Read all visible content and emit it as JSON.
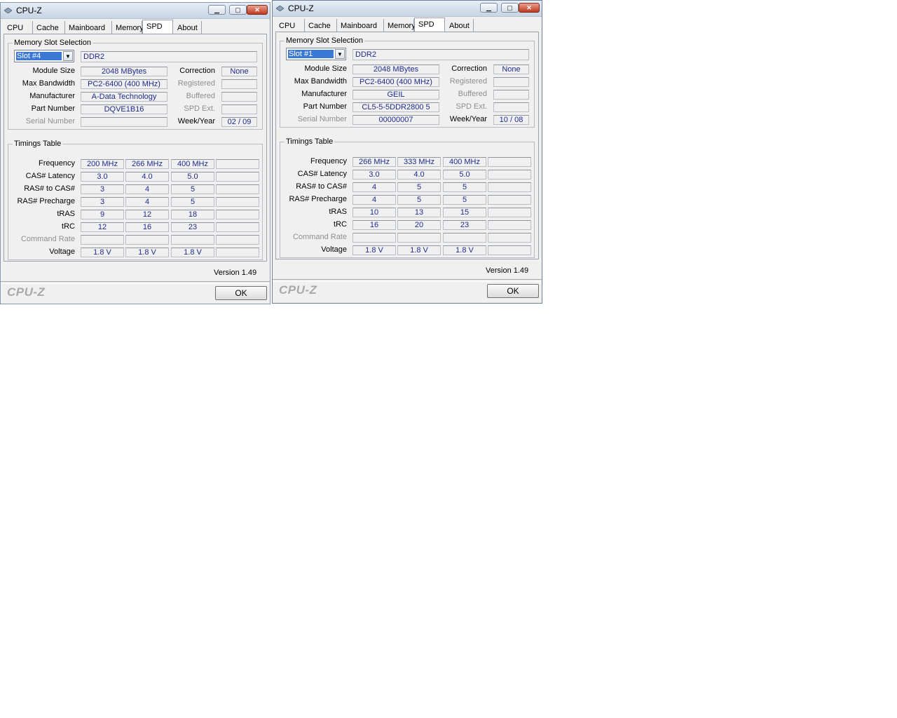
{
  "windows": [
    {
      "title": "CPU-Z",
      "tabs": [
        "CPU",
        "Cache",
        "Mainboard",
        "Memory",
        "SPD",
        "About"
      ],
      "active_tab": "SPD",
      "memory_slot_selection": {
        "group_title": "Memory Slot Selection",
        "slot": "Slot #4",
        "type": "DDR2",
        "module_size_label": "Module Size",
        "module_size": "2048 MBytes",
        "max_bandwidth_label": "Max Bandwidth",
        "max_bandwidth": "PC2-6400 (400 MHz)",
        "manufacturer_label": "Manufacturer",
        "manufacturer": "A-Data Technology",
        "part_number_label": "Part Number",
        "part_number": "DQVE1B16",
        "serial_number_label": "Serial Number",
        "serial_number": "",
        "correction_label": "Correction",
        "correction": "None",
        "registered_label": "Registered",
        "registered": "",
        "buffered_label": "Buffered",
        "buffered": "",
        "spd_ext_label": "SPD Ext.",
        "spd_ext": "",
        "week_year_label": "Week/Year",
        "week_year": "02 / 09"
      },
      "timings_table": {
        "group_title": "Timings Table",
        "rows": [
          {
            "label": "Frequency",
            "values": [
              "200 MHz",
              "266 MHz",
              "400 MHz",
              ""
            ]
          },
          {
            "label": "CAS# Latency",
            "values": [
              "3.0",
              "4.0",
              "5.0",
              ""
            ]
          },
          {
            "label": "RAS# to CAS#",
            "values": [
              "3",
              "4",
              "5",
              ""
            ]
          },
          {
            "label": "RAS# Precharge",
            "values": [
              "3",
              "4",
              "5",
              ""
            ]
          },
          {
            "label": "tRAS",
            "values": [
              "9",
              "12",
              "18",
              ""
            ]
          },
          {
            "label": "tRC",
            "values": [
              "12",
              "16",
              "23",
              ""
            ]
          },
          {
            "label": "Command Rate",
            "values": [
              "",
              "",
              "",
              ""
            ]
          },
          {
            "label": "Voltage",
            "values": [
              "1.8 V",
              "1.8 V",
              "1.8 V",
              ""
            ]
          }
        ]
      },
      "version": "Version 1.49",
      "logo": "CPU-Z",
      "ok_label": "OK"
    },
    {
      "title": "CPU-Z",
      "tabs": [
        "CPU",
        "Cache",
        "Mainboard",
        "Memory",
        "SPD",
        "About"
      ],
      "active_tab": "SPD",
      "memory_slot_selection": {
        "group_title": "Memory Slot Selection",
        "slot": "Slot #1",
        "type": "DDR2",
        "module_size_label": "Module Size",
        "module_size": "2048 MBytes",
        "max_bandwidth_label": "Max Bandwidth",
        "max_bandwidth": "PC2-6400 (400 MHz)",
        "manufacturer_label": "Manufacturer",
        "manufacturer": "GEIL",
        "part_number_label": "Part Number",
        "part_number": "CL5-5-5DDR2800  5",
        "serial_number_label": "Serial Number",
        "serial_number": "00000007",
        "correction_label": "Correction",
        "correction": "None",
        "registered_label": "Registered",
        "registered": "",
        "buffered_label": "Buffered",
        "buffered": "",
        "spd_ext_label": "SPD Ext.",
        "spd_ext": "",
        "week_year_label": "Week/Year",
        "week_year": "10 / 08"
      },
      "timings_table": {
        "group_title": "Timings Table",
        "rows": [
          {
            "label": "Frequency",
            "values": [
              "266 MHz",
              "333 MHz",
              "400 MHz",
              ""
            ]
          },
          {
            "label": "CAS# Latency",
            "values": [
              "3.0",
              "4.0",
              "5.0",
              ""
            ]
          },
          {
            "label": "RAS# to CAS#",
            "values": [
              "4",
              "5",
              "5",
              ""
            ]
          },
          {
            "label": "RAS# Precharge",
            "values": [
              "4",
              "5",
              "5",
              ""
            ]
          },
          {
            "label": "tRAS",
            "values": [
              "10",
              "13",
              "15",
              ""
            ]
          },
          {
            "label": "tRC",
            "values": [
              "16",
              "20",
              "23",
              ""
            ]
          },
          {
            "label": "Command Rate",
            "values": [
              "",
              "",
              "",
              ""
            ]
          },
          {
            "label": "Voltage",
            "values": [
              "1.8 V",
              "1.8 V",
              "1.8 V",
              ""
            ]
          }
        ]
      },
      "version": "Version 1.49",
      "logo": "CPU-Z",
      "ok_label": "OK"
    }
  ],
  "colors": {
    "value_text": "#1e2a8f",
    "selection": "#3a78d8",
    "dim_label": "#8e8e8e"
  }
}
